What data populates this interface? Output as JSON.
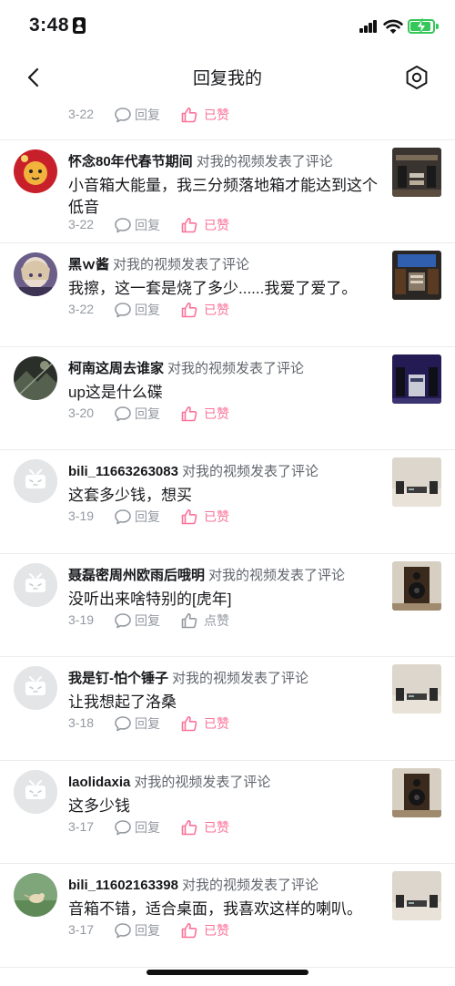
{
  "status_bar": {
    "time": "3:48"
  },
  "nav": {
    "title": "回复我的"
  },
  "partial_row": {
    "date": "3-22",
    "reply_label": "回复",
    "like_label": "已赞",
    "liked": true
  },
  "items": [
    {
      "username": "怀念80年代春节期间",
      "action": "对我的视频发表了评论",
      "comment": "小音箱大能量，我三分频落地箱才能达到这个低音",
      "date": "3-22",
      "reply_label": "回复",
      "like_label": "已赞",
      "liked": true,
      "avatar": "red-tiger-avatar",
      "thumb": "audio-room-thumb"
    },
    {
      "username": "黑ｗ酱",
      "action": "对我的视频发表了评论",
      "comment": "我擦，这一套是烧了多少......我爱了爱了。",
      "date": "3-22",
      "reply_label": "回复",
      "like_label": "已赞",
      "liked": true,
      "avatar": "anime-girl-avatar",
      "thumb": "audio-wall-thumb"
    },
    {
      "username": "柯南这周去谁家",
      "action": "对我的视频发表了评论",
      "comment": "up这是什么碟",
      "date": "3-20",
      "reply_label": "回复",
      "like_label": "已赞",
      "liked": true,
      "avatar": "dark-photo-avatar",
      "thumb": "stage-speakers-thumb"
    },
    {
      "username": "bili_11663263083",
      "action": "对我的视频发表了评论",
      "comment": "这套多少钱，想买",
      "date": "3-19",
      "reply_label": "回复",
      "like_label": "已赞",
      "liked": true,
      "avatar": "default-tv-avatar",
      "thumb": "desk-speakers-thumb"
    },
    {
      "username": "聂磊密周州欧雨后哦明",
      "action": "对我的视频发表了评论",
      "comment": "没听出来啥特别的[虎年]",
      "date": "3-19",
      "reply_label": "回复",
      "like_label": "点赞",
      "liked": false,
      "avatar": "default-tv-avatar",
      "thumb": "bookshelf-speaker-thumb"
    },
    {
      "username": "我是钉-怕个锤子",
      "action": "对我的视频发表了评论",
      "comment": "让我想起了洛桑",
      "date": "3-18",
      "reply_label": "回复",
      "like_label": "已赞",
      "liked": true,
      "avatar": "default-tv-avatar",
      "thumb": "desk-speakers-thumb"
    },
    {
      "username": "laolidaxia",
      "action": "对我的视频发表了评论",
      "comment": "这多少钱",
      "date": "3-17",
      "reply_label": "回复",
      "like_label": "已赞",
      "liked": true,
      "avatar": "default-tv-avatar",
      "thumb": "bookshelf-speaker-thumb"
    },
    {
      "username": "bili_11602163398",
      "action": "对我的视频发表了评论",
      "comment": "音箱不错，适合桌面，我喜欢这样的喇叭。",
      "date": "3-17",
      "reply_label": "回复",
      "like_label": "已赞",
      "liked": true,
      "avatar": "bird-avatar",
      "thumb": "desk-speakers-thumb"
    }
  ],
  "colors": {
    "accent_pink": "#fb7299",
    "muted_gray": "#9499a0",
    "action_gray": "#61666d",
    "battery_green": "#34c759"
  }
}
